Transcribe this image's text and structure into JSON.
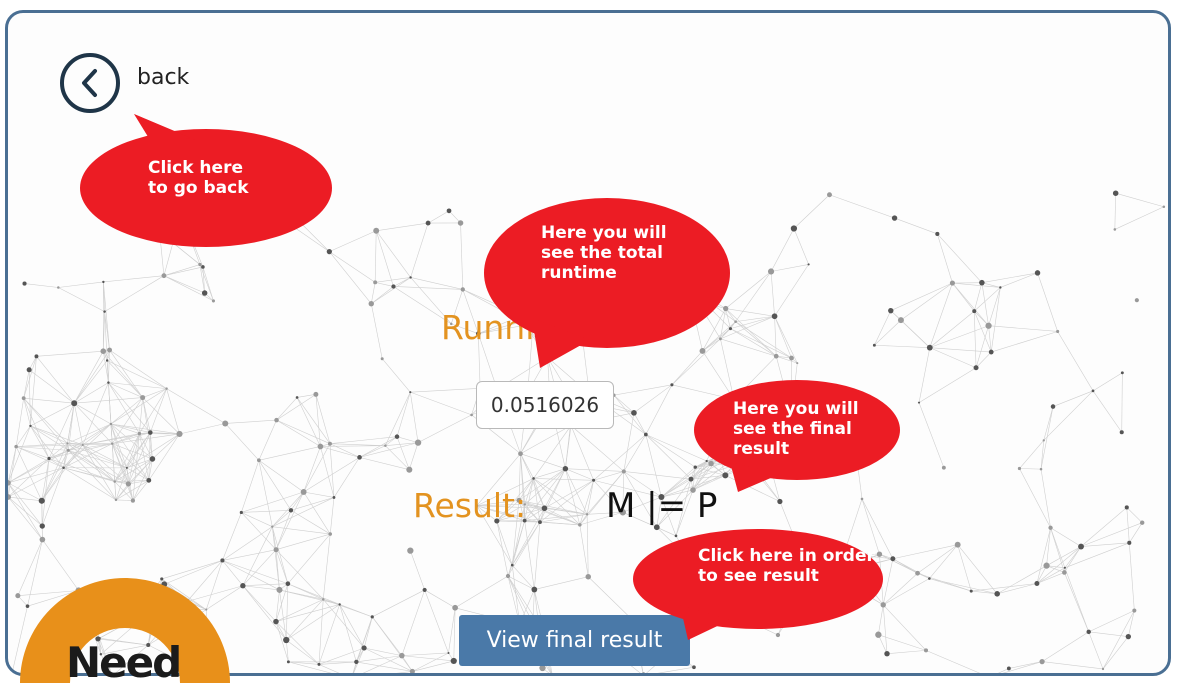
{
  "nav": {
    "back_label": "back",
    "back_icon": "chevron-left-icon"
  },
  "main": {
    "runtime_heading": "Runni",
    "runtime_value": "0.0516026",
    "result_label": "Result:",
    "result_value": "M |= P",
    "view_button_label": "View final result"
  },
  "callouts": {
    "back": "Click here\nto go back",
    "runtime": "Here you will\nsee the total\nruntime",
    "result": "Here you will\nsee the final\nresult",
    "view": "Click here in order\nto see result"
  },
  "logo": {
    "text": "Need"
  },
  "colors": {
    "frame": "#4a6f93",
    "accent_orange": "#e39320",
    "callout_red": "#ec1c24",
    "button_blue": "#4a79a8",
    "logo_orange": "#e8901a"
  }
}
